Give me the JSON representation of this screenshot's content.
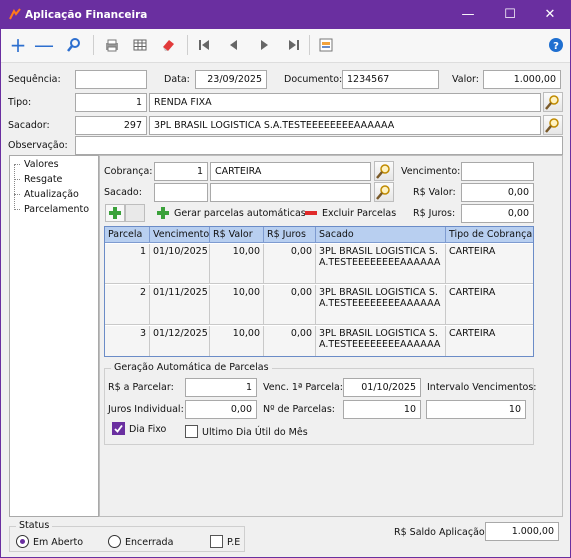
{
  "window": {
    "title": "Aplicação Financeira"
  },
  "toolbar": {
    "icons": [
      "add-icon",
      "remove-icon",
      "search-icon",
      "print-icon",
      "grid-icon",
      "eraser-icon",
      "first-icon",
      "prev-icon",
      "next-icon",
      "last-icon",
      "report-icon",
      "help-icon"
    ]
  },
  "header": {
    "sequencia_label": "Sequência:",
    "sequencia_value": "",
    "data_label": "Data:",
    "data_value": "23/09/2025",
    "documento_label": "Documento:",
    "documento_value": "1234567",
    "valor_label": "Valor:",
    "valor_value": "1.000,00",
    "tipo_label": "Tipo:",
    "tipo_code": "1",
    "tipo_name": "RENDA FIXA",
    "sacador_label": "Sacador:",
    "sacador_code": "297",
    "sacador_name": "3PL BRASIL LOGISTICA S.A.TESTEEEEEEEEAAAAAA",
    "observacao_label": "Observação:",
    "observacao_value": ""
  },
  "tree": {
    "items": [
      "Valores",
      "Resgate",
      "Atualização",
      "Parcelamento"
    ]
  },
  "parcelamento": {
    "cobranca_label": "Cobrança:",
    "cobranca_code": "1",
    "cobranca_name": "CARTEIRA",
    "sacado_label": "Sacado:",
    "sacado_code": "",
    "sacado_name": "",
    "vencimento_label": "Vencimento:",
    "vencimento_value": "",
    "rs_valor_label": "R$ Valor:",
    "rs_valor_value": "0,00",
    "rs_juros_label": "R$ Juros:",
    "rs_juros_value": "0,00",
    "gerar_label": "Gerar parcelas automáticas",
    "excluir_label": "Excluir Parcelas",
    "grid": {
      "columns": [
        "Parcela",
        "Vencimento",
        "R$ Valor",
        "R$ Juros",
        "Sacado",
        "Tipo de Cobrança"
      ],
      "rows": [
        {
          "parcela": "1",
          "vencimento": "01/10/2025",
          "valor": "10,00",
          "juros": "0,00",
          "sacado": "3PL BRASIL LOGISTICA S.A.TESTEEEEEEEEAAAAAA",
          "tipo": "CARTEIRA"
        },
        {
          "parcela": "2",
          "vencimento": "01/11/2025",
          "valor": "10,00",
          "juros": "0,00",
          "sacado": "3PL BRASIL LOGISTICA S.A.TESTEEEEEEEEAAAAAA",
          "tipo": "CARTEIRA"
        },
        {
          "parcela": "3",
          "vencimento": "01/12/2025",
          "valor": "10,00",
          "juros": "0,00",
          "sacado": "3PL BRASIL LOGISTICA S.A.TESTEEEEEEEEAAAAAA",
          "tipo": "CARTEIRA"
        }
      ]
    },
    "geracao": {
      "legend": "Geração Automática de Parcelas",
      "rs_parcelar_label": "R$ a Parcelar:",
      "rs_parcelar_value": "1",
      "venc_1_label": "Venc. 1ª Parcela:",
      "venc_1_value": "01/10/2025",
      "intervalo_label": "Intervalo Vencimentos:",
      "intervalo_value": "10",
      "juros_label": "Juros Individual:",
      "juros_value": "0,00",
      "num_parcelas_label": "Nº de Parcelas:",
      "num_parcelas_value": "10",
      "dia_fixo_label": "Dia Fixo",
      "dia_fixo_checked": true,
      "ultimo_dia_label": "Ultimo Dia Útil do Mês",
      "ultimo_dia_checked": false
    }
  },
  "status": {
    "legend": "Status",
    "em_aberto_label": "Em Aberto",
    "encerrada_label": "Encerrada",
    "pe_label": "P.E",
    "selected": "Em Aberto",
    "saldo_label": "R$ Saldo Aplicação:",
    "saldo_value": "1.000,00"
  },
  "colors": {
    "accent": "#6a2fa0",
    "grid_header": "#b8cff0",
    "help": "#1f6fd0"
  }
}
